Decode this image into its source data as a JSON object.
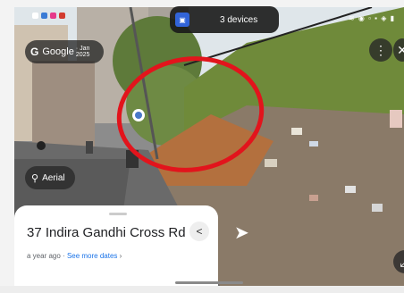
{
  "status_bar": {
    "right_icons": "≋ ◉ ▫ ▪ ◈ ▮"
  },
  "devices": {
    "label": "3 devices"
  },
  "google_pill": {
    "logo": "G",
    "label": "Google",
    "date": "· Jan 2025"
  },
  "aerial": {
    "label": "Aerial"
  },
  "card": {
    "address": "37 Indira Gandhi Cross Rd",
    "age": "a year ago ·",
    "link": "See more dates",
    "chevron": "›"
  },
  "icons": {
    "share": "share-icon",
    "more": "more-vert-icon",
    "close": "close-icon",
    "arrow": "navigation-arrow-icon",
    "aerial": "aerial-person-icon"
  },
  "colors": {
    "highlight": "#e2141c",
    "link": "#1a73e8"
  }
}
